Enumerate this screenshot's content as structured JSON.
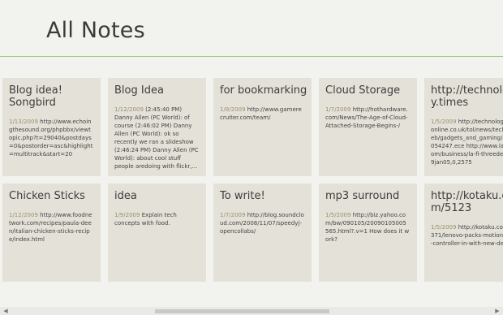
{
  "page": {
    "title": "All Notes"
  },
  "notes": [
    {
      "title": "Blog idea! Songbird",
      "date": "1/13/2009",
      "text": "http://www.echoingthesound.org/phpbbx/viewtopic.php?t=29040&postdays=0&postorder=asc&highlight=multitrack&start=20"
    },
    {
      "title": "Blog Idea",
      "date": "1/12/2009",
      "text": "(2:45:40 PM) Danny Allen (PC World): of course (2:46:02 PM) Danny Allen (PC World): ok so recently we ran a slideshow (2:46:24 PM) Danny Allen (PC World): about cool stuff people aredoing with flickr,..."
    },
    {
      "title": "for bookmarking",
      "date": "1/9/2009",
      "text": "http://www.gamerecruiter.com/team/"
    },
    {
      "title": "Cloud Storage",
      "date": "1/7/2009",
      "text": "http://hothardware.com/News/The-Age-of-Cloud-Attached-Storage-Begins-/"
    },
    {
      "title": "http://technology.times",
      "date": "1/5/2009",
      "text": "http://technology.timesonline.co.uk/tol/news/tech_and_web/gadgets_and_gaming/article5054247.ece http://www.latimes.com/business/la-fi-threedee5-2009jan05,0,2575"
    },
    {
      "title": "Chicken Sticks",
      "date": "1/12/2009",
      "text": "http://www.foodnetwork.com/recipes/paula-deen/italian-chicken-sticks-recipe/index.html"
    },
    {
      "title": "idea",
      "date": "1/9/2009",
      "text": "Explain tech concepts with food."
    },
    {
      "title": "To write!",
      "date": "1/7/2009",
      "text": "http://blog.soundcloud.com/2008/11/07/speedyj-opencollabs/"
    },
    {
      "title": "mp3 surround",
      "date": "1/5/2009",
      "text": "http://biz.yahoo.com/bw/090105/20090105005565.html?.v=1 How does it work?"
    },
    {
      "title": "http://kotaku.com/5123",
      "date": "1/5/2009",
      "text": "http://kotaku.com/5123371/lenovo-packs-motion-gaming-controller-in-with-new-desktop"
    }
  ],
  "scrollbar": {
    "left_arrow": "◀",
    "right_arrow": "▶",
    "position": 0.47,
    "visible_fraction": 0.36
  }
}
